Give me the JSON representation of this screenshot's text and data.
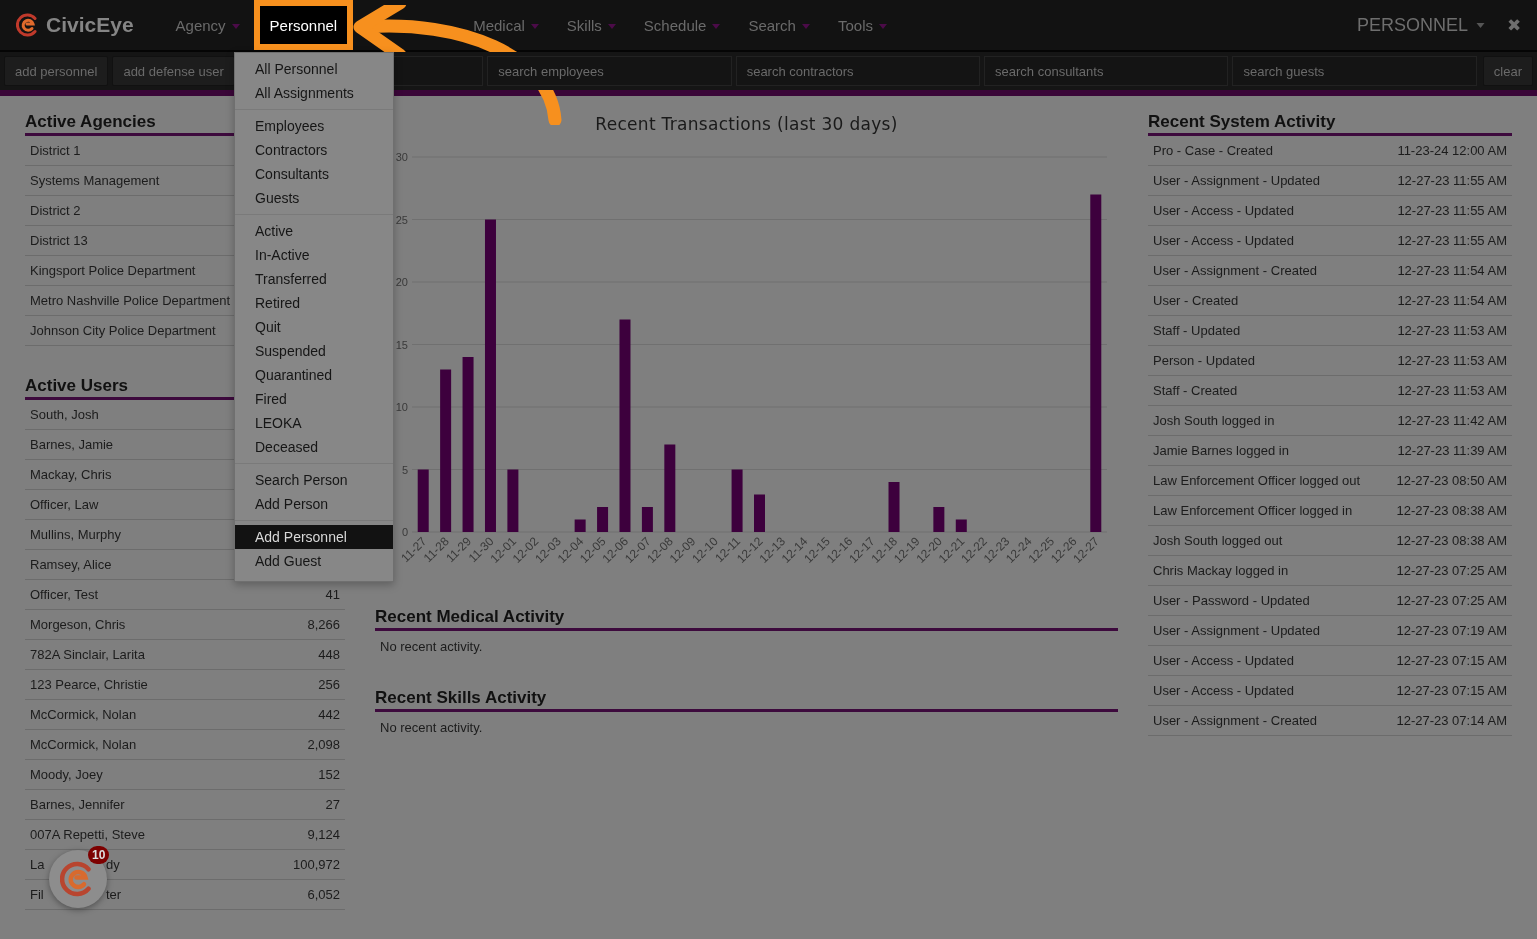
{
  "brand": {
    "name": "CivicEye"
  },
  "nav": [
    {
      "label": "Agency",
      "selected": false
    },
    {
      "label": "Personnel",
      "selected": true
    },
    {
      "label": "Medical",
      "selected": false
    },
    {
      "label": "Skills",
      "selected": false
    },
    {
      "label": "Schedule",
      "selected": false
    },
    {
      "label": "Search",
      "selected": false
    },
    {
      "label": "Tools",
      "selected": false
    }
  ],
  "module_menu": {
    "label": "PERSONNEL"
  },
  "close": {
    "label": "✖"
  },
  "toolbar": {
    "buttons": [
      "add personnel",
      "add defense user"
    ],
    "fields": [
      {
        "placeholder": "search employees"
      },
      {
        "placeholder": "search contractors"
      },
      {
        "placeholder": "search consultants"
      },
      {
        "placeholder": "search guests"
      }
    ],
    "clear": "clear"
  },
  "dropdown": {
    "groups": [
      [
        {
          "label": "All Personnel",
          "selected": false
        },
        {
          "label": "All Assignments",
          "selected": false
        }
      ],
      [
        {
          "label": "Employees",
          "selected": false
        },
        {
          "label": "Contractors",
          "selected": false
        },
        {
          "label": "Consultants",
          "selected": false
        },
        {
          "label": "Guests",
          "selected": false
        }
      ],
      [
        {
          "label": "Active",
          "selected": false
        },
        {
          "label": "In-Active",
          "selected": false
        },
        {
          "label": "Transferred",
          "selected": false
        },
        {
          "label": "Retired",
          "selected": false
        },
        {
          "label": "Quit",
          "selected": false
        },
        {
          "label": "Suspended",
          "selected": false
        },
        {
          "label": "Quarantined",
          "selected": false
        },
        {
          "label": "Fired",
          "selected": false
        },
        {
          "label": "LEOKA",
          "selected": false
        },
        {
          "label": "Deceased",
          "selected": false
        }
      ],
      [
        {
          "label": "Search Person",
          "selected": false
        },
        {
          "label": "Add Person",
          "selected": false
        }
      ],
      [
        {
          "label": "Add Personnel",
          "selected": true
        },
        {
          "label": "Add Guest",
          "selected": false
        }
      ]
    ]
  },
  "agencies": {
    "title": "Active Agencies",
    "rows": [
      "District 1",
      "Systems Management",
      "District 2",
      "District 13",
      "Kingsport Police Department",
      "Metro Nashville Police Department",
      "Johnson City Police Department"
    ]
  },
  "users": {
    "title": "Active Users",
    "rows": [
      {
        "name": "South, Josh"
      },
      {
        "name": "Barnes, Jamie"
      },
      {
        "name": "Mackay, Chris"
      },
      {
        "name": "Officer, Law"
      },
      {
        "name": "Mullins, Murphy"
      },
      {
        "name": "Ramsey, Alice"
      },
      {
        "name": "Officer, Test",
        "count": "41"
      },
      {
        "name": "Morgeson, Chris",
        "count": "8,266"
      },
      {
        "name": "782A Sinclair, Larita",
        "count": "448"
      },
      {
        "name": "123 Pearce, Christie",
        "count": "256"
      },
      {
        "name": "McCormick, Nolan",
        "count": "442"
      },
      {
        "name": "McCormick, Nolan",
        "count": "2,098"
      },
      {
        "name": "Moody, Joey",
        "count": "152"
      },
      {
        "name": "Barnes, Jennifer",
        "count": "27"
      },
      {
        "name": "007A Repetti, Steve",
        "count": "9,124"
      },
      {
        "name": "La",
        "name_tail": "dy",
        "count": "100,972"
      },
      {
        "name": "Fil",
        "name_tail": "ter",
        "count": "6,052"
      }
    ]
  },
  "transactions": {
    "chart_data": {
      "type": "bar",
      "title": "Recent Transactions (last 30 days)",
      "categories": [
        "11-27",
        "11-28",
        "11-29",
        "11-30",
        "12-01",
        "12-02",
        "12-03",
        "12-04",
        "12-05",
        "12-06",
        "12-07",
        "12-08",
        "12-09",
        "12-10",
        "12-11",
        "12-12",
        "12-13",
        "12-14",
        "12-15",
        "12-16",
        "12-17",
        "12-18",
        "12-19",
        "12-20",
        "12-21",
        "12-22",
        "12-23",
        "12-24",
        "12-25",
        "12-26",
        "12-27"
      ],
      "series": [
        {
          "color": "#3d003d",
          "values": [
            5,
            13,
            14,
            25,
            5,
            0,
            0,
            1,
            2,
            17,
            2,
            7,
            0,
            0,
            5,
            3,
            0,
            0,
            0,
            0,
            0,
            4,
            0,
            2,
            1,
            0,
            0,
            0,
            0,
            0,
            27
          ]
        }
      ],
      "grid": true,
      "ylim": [
        0,
        30
      ],
      "yticks": [
        0,
        5,
        10,
        15,
        20,
        25,
        30
      ]
    }
  },
  "medical": {
    "title": "Recent Medical Activity",
    "empty": "No recent activity."
  },
  "skills": {
    "title": "Recent Skills Activity",
    "empty": "No recent activity."
  },
  "system": {
    "title": "Recent System Activity",
    "rows": [
      {
        "event": "Pro - Case - Created",
        "time": "11-23-24 12:00 AM"
      },
      {
        "event": "User - Assignment - Updated",
        "time": "12-27-23 11:55 AM"
      },
      {
        "event": "User - Access - Updated",
        "time": "12-27-23 11:55 AM"
      },
      {
        "event": "User - Access - Updated",
        "time": "12-27-23 11:55 AM"
      },
      {
        "event": "User - Assignment - Created",
        "time": "12-27-23 11:54 AM"
      },
      {
        "event": "User - Created",
        "time": "12-27-23 11:54 AM"
      },
      {
        "event": "Staff - Updated",
        "time": "12-27-23 11:53 AM"
      },
      {
        "event": "Person - Updated",
        "time": "12-27-23 11:53 AM"
      },
      {
        "event": "Staff - Created",
        "time": "12-27-23 11:53 AM"
      },
      {
        "event": "Josh South logged in",
        "time": "12-27-23 11:42 AM"
      },
      {
        "event": "Jamie Barnes logged in",
        "time": "12-27-23 11:39 AM"
      },
      {
        "event": "Law Enforcement Officer logged out",
        "time": "12-27-23 08:50 AM"
      },
      {
        "event": "Law Enforcement Officer logged in",
        "time": "12-27-23 08:38 AM"
      },
      {
        "event": "Josh South logged out",
        "time": "12-27-23 08:38 AM"
      },
      {
        "event": "Chris Mackay logged in",
        "time": "12-27-23 07:25 AM"
      },
      {
        "event": "User - Password - Updated",
        "time": "12-27-23 07:25 AM"
      },
      {
        "event": "User - Assignment - Updated",
        "time": "12-27-23 07:19 AM"
      },
      {
        "event": "User - Access - Updated",
        "time": "12-27-23 07:15 AM"
      },
      {
        "event": "User - Access - Updated",
        "time": "12-27-23 07:15 AM"
      },
      {
        "event": "User - Assignment - Created",
        "time": "12-27-23 07:14 AM"
      }
    ]
  },
  "chat": {
    "badge": "10"
  }
}
